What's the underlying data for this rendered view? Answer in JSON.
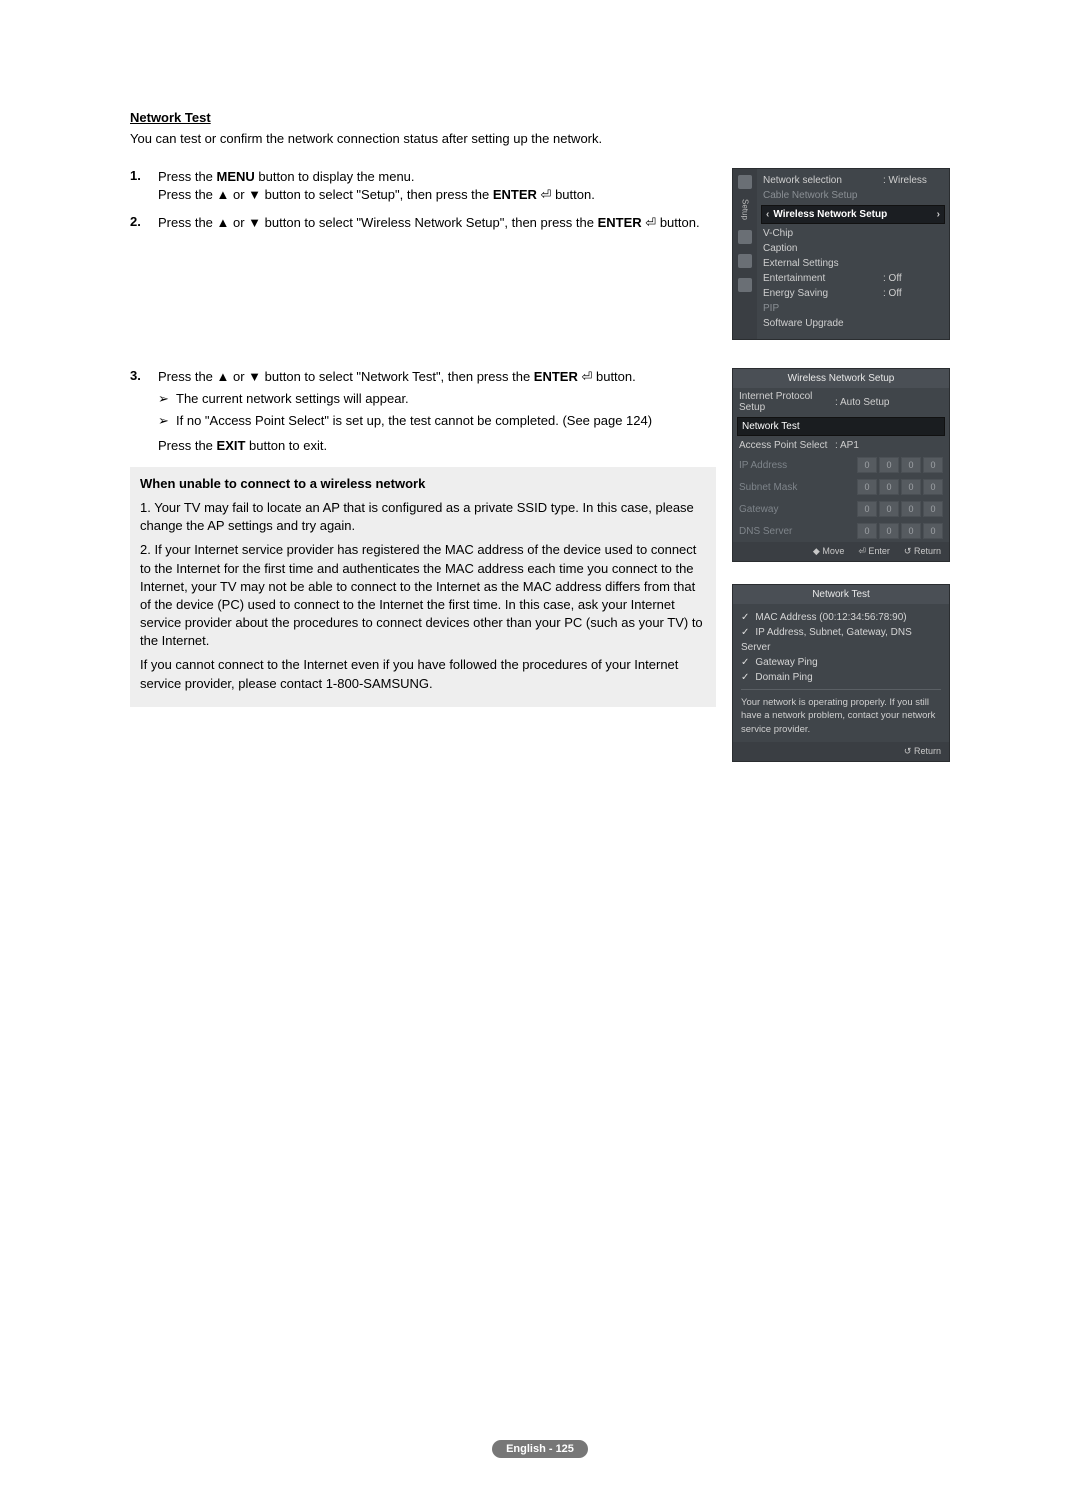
{
  "title": "Network Test",
  "intro": "You can test or confirm the network connection status after setting up the network.",
  "steps": {
    "s1": {
      "num": "1.",
      "l1a": "Press the ",
      "l1b": "MENU",
      "l1c": " button to display the menu.",
      "l2a": "Press the ▲ or ▼ button to select \"Setup\", then press the ",
      "l2b": "ENTER",
      "l2c": " button."
    },
    "s2": {
      "num": "2.",
      "l1a": "Press the ▲ or ▼ button to select \"Wireless Network Setup\", then press the ",
      "l1b": "ENTER",
      "l1c": " button."
    },
    "s3": {
      "num": "3.",
      "l1a": "Press the ▲ or ▼ button to select \"Network Test\", then press the ",
      "l1b": "ENTER",
      "l1c": " button.",
      "sub1": "The current network settings will appear.",
      "sub2": "If no \"Access Point Select\" is set up, the test cannot be completed. (See page 124)",
      "exit_a": "Press the ",
      "exit_b": "EXIT",
      "exit_c": " button to exit."
    }
  },
  "info": {
    "title": "When unable to connect to a wireless network",
    "p1": "1. Your TV may fail to locate an AP that is configured as a private SSID type. In this case, please change the AP settings and try again.",
    "p2": "2. If your Internet service provider has registered the MAC address of the device used to connect to the Internet for the first time and authenticates the MAC address each time you connect to the Internet, your TV may not be able to connect to the Internet as the MAC address differs from that of the device (PC) used to connect to the Internet the first time. In this case, ask your Internet service provider about the procedures to connect devices other than your PC (such as your TV) to the Internet.",
    "p3": "If you cannot connect to the Internet even if you have followed the procedures of your Internet service provider, please contact 1-800-SAMSUNG."
  },
  "osd1": {
    "side_label": "Setup",
    "rows": [
      {
        "k": "Network selection",
        "v": ": Wireless",
        "dim": false
      },
      {
        "k": "Cable Network Setup",
        "v": "",
        "dim": true
      }
    ],
    "selected": "Wireless Network Setup",
    "rows2": [
      {
        "k": "V-Chip",
        "v": ""
      },
      {
        "k": "Caption",
        "v": ""
      },
      {
        "k": "External Settings",
        "v": ""
      },
      {
        "k": "Entertainment",
        "v": ": Off"
      },
      {
        "k": "Energy Saving",
        "v": ": Off"
      },
      {
        "k": "PIP",
        "v": "",
        "dim": true
      },
      {
        "k": "Software Upgrade",
        "v": ""
      }
    ]
  },
  "osd2": {
    "title": "Wireless Network Setup",
    "rows": [
      {
        "k": "Internet Protocol Setup",
        "v": ": Auto Setup",
        "sel": false
      },
      {
        "k": "Network Test",
        "v": "",
        "sel": true
      },
      {
        "k": "Access Point Select",
        "v": ": AP1",
        "sel": false
      }
    ],
    "ip_rows": [
      {
        "k": "IP Address"
      },
      {
        "k": "Subnet Mask"
      },
      {
        "k": "Gateway"
      },
      {
        "k": "DNS Server"
      }
    ],
    "ip_val": "0",
    "footer": {
      "move": "Move",
      "enter": "Enter",
      "ret": "Return"
    }
  },
  "osd3": {
    "title": "Network Test",
    "items": [
      "MAC Address (00:12:34:56:78:90)",
      "IP Address, Subnet, Gateway, DNS Server",
      "Gateway Ping",
      "Domain Ping"
    ],
    "msg": "Your network is operating properly. If you still have a network problem, contact your network service provider.",
    "ret": "Return"
  },
  "footer": "English - 125",
  "glyph": {
    "enter": "⏎",
    "ret": "↺",
    "updown": "◆",
    "enter2": "⏎"
  }
}
